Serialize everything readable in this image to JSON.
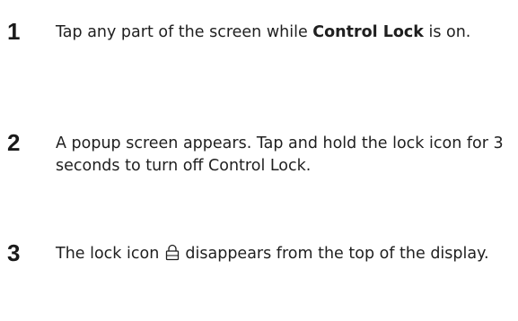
{
  "steps": [
    {
      "number": "1",
      "text_before": "Tap any part of the screen while ",
      "bold": "Control Lock",
      "text_after": " is on."
    },
    {
      "number": "2",
      "text": "A popup screen appears. Tap and hold the lock icon for 3 seconds to turn off Control Lock."
    },
    {
      "number": "3",
      "text_before": "The lock icon ",
      "icon": "lock-icon",
      "text_after": " disappears from the top of the display."
    }
  ]
}
